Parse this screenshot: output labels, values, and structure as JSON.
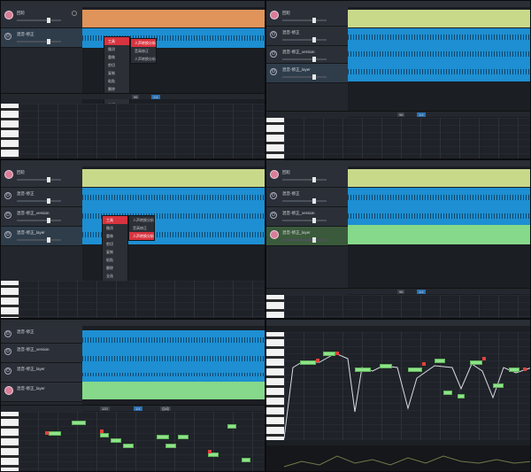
{
  "tracks": {
    "t1": "回轮",
    "t2": "混音-修正",
    "t3": "混音-修正_version",
    "t4": "混音-修正_layer",
    "t5": "混音-修正_layer"
  },
  "menu": {
    "items": [
      "工具",
      "撤消",
      "重做",
      "剪切",
      "复制",
      "粘贴",
      "删除",
      "全选",
      "选择",
      "重新渲染",
      "分析"
    ],
    "sub": [
      "人声转换分析",
      "音高修正",
      "人声转换分析"
    ]
  },
  "toolbar": {
    "zoom": "96",
    "snap": "1/4",
    "mode": "自动",
    "tempo": "120"
  },
  "colors": {
    "accent": "#1d8fd2",
    "highlight": "#d8343f",
    "note": "#8fe38a"
  }
}
